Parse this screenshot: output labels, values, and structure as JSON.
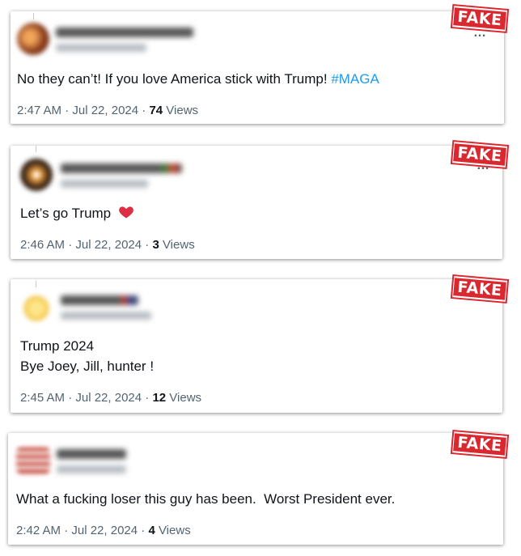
{
  "stamp_label": "FAKE",
  "more_glyph": "…",
  "colors": {
    "stamp": "#d9282f",
    "hashtag": "#1d9bf0",
    "meta": "#536471"
  },
  "tweets": [
    {
      "text_main": "No they can’t! If you love America stick with Trump! ",
      "hashtag": "#MAGA",
      "time": "2:47 AM · Jul 22, 2024 · ",
      "views_count": "74",
      "views_label": " Views"
    },
    {
      "text_main": "Let’s go Trump ",
      "emoji": "red-heart-icon",
      "time": "2:46 AM · Jul 22, 2024 · ",
      "views_count": "3",
      "views_label": " Views"
    },
    {
      "text_line1": "Trump 2024",
      "text_line2": "Bye Joey, Jill, hunter !",
      "time": "2:45 AM · Jul 22, 2024 · ",
      "views_count": "12",
      "views_label": " Views"
    },
    {
      "text_main": "What a fucking loser this guy has been.  Worst President ever.",
      "time": "2:42 AM · Jul 22, 2024 · ",
      "views_count": "4",
      "views_label": " Views"
    }
  ]
}
